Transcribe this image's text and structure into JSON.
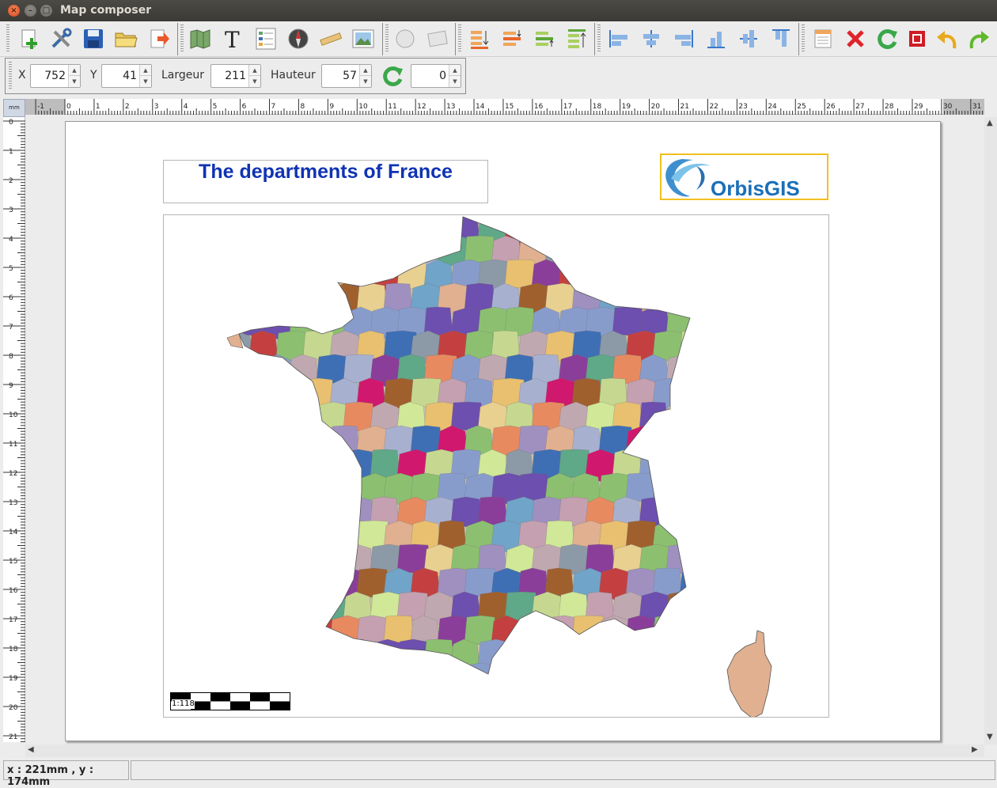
{
  "window": {
    "title": "Map composer"
  },
  "toolbar": {
    "groups": [
      [
        "add-icon",
        "settings-icon",
        "save-icon",
        "open-folder-icon",
        "export-icon"
      ],
      [
        "map-icon",
        "text-icon",
        "legend-icon",
        "north-arrow-icon",
        "scale-icon",
        "image-icon"
      ],
      [
        "circle-icon",
        "rectangle-icon"
      ],
      [
        "move-to-back-icon",
        "move-backward-icon",
        "move-forward-icon",
        "move-to-front-icon"
      ],
      [
        "align-left-icon",
        "align-center-icon",
        "align-right-icon",
        "align-bottom-icon",
        "align-middle-icon",
        "align-top-icon"
      ],
      [
        "properties-icon",
        "delete-icon",
        "refresh-icon",
        "stop-icon",
        "undo-icon",
        "redo-icon"
      ]
    ]
  },
  "properties": {
    "x_label": "X",
    "x_value": "752",
    "y_label": "Y",
    "y_value": "41",
    "width_label": "Largeur",
    "width_value": "211",
    "height_label": "Hauteur",
    "height_value": "57",
    "rotation_icon": "rotate-icon",
    "rotation_value": "0"
  },
  "rulers": {
    "unit": "mm",
    "horizontal_labels": [
      "-1",
      "0",
      "1",
      "2",
      "3",
      "4",
      "5",
      "6",
      "7",
      "8",
      "9",
      "10",
      "11",
      "12",
      "13",
      "14",
      "15",
      "16",
      "17",
      "18",
      "19",
      "20",
      "21",
      "22",
      "23",
      "24",
      "25",
      "26",
      "27",
      "28",
      "29",
      "30",
      "31"
    ],
    "vertical_labels": [
      "0",
      "1",
      "2",
      "3",
      "4",
      "5",
      "6",
      "7",
      "8",
      "9",
      "10",
      "11",
      "12",
      "13",
      "14",
      "15",
      "16",
      "17",
      "18",
      "19",
      "20",
      "21"
    ]
  },
  "document": {
    "title": "The departments of France",
    "logo_text": "OrbisGIS",
    "scale_label": "1:118"
  },
  "status": {
    "coordinates": "x : 221mm , y : 174mm"
  },
  "colors": {
    "title_blue": "#1033b3",
    "logo_frame": "#f2c01e",
    "department_palette": [
      "#e0b090",
      "#c0a8b0",
      "#e8c070",
      "#3e6fb5",
      "#8c9aa8",
      "#a8b0d0",
      "#6c4fae",
      "#8a3e9a",
      "#d0186e",
      "#5fa888",
      "#e8d090",
      "#a0602e",
      "#c44040",
      "#8cc070",
      "#c6d890",
      "#70a4c8",
      "#a090c0",
      "#c4a0b0",
      "#e88a60",
      "#d0e898",
      "#889ccc"
    ]
  }
}
